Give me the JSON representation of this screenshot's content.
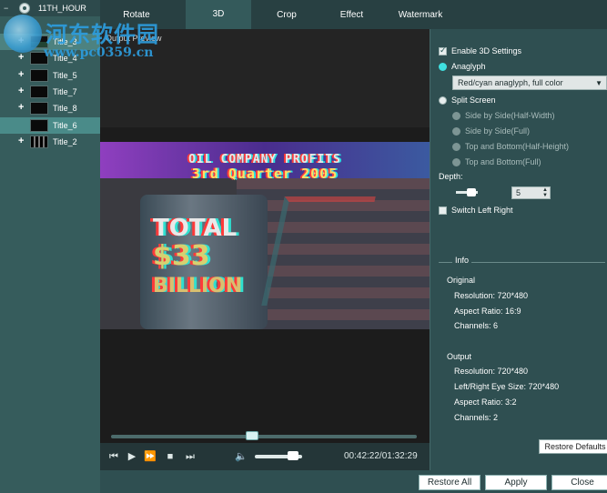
{
  "tree": {
    "root_label": "11TH_HOUR",
    "items": [
      {
        "label": "Title_3",
        "expander": "+"
      },
      {
        "label": "Title_4",
        "expander": "+"
      },
      {
        "label": "Title_5",
        "expander": "+"
      },
      {
        "label": "Title_7",
        "expander": "+"
      },
      {
        "label": "Title_8",
        "expander": "+"
      },
      {
        "label": "Title_6",
        "expander": ""
      },
      {
        "label": "Title_2",
        "expander": "+"
      }
    ]
  },
  "watermark": {
    "cn": "河东软件园",
    "url": "www.pc0359.cn"
  },
  "tabs": [
    {
      "label": "Rotate",
      "active": false
    },
    {
      "label": "3D",
      "active": true
    },
    {
      "label": "Crop",
      "active": false
    },
    {
      "label": "Effect",
      "active": false
    },
    {
      "label": "Watermark",
      "active": false
    }
  ],
  "preview": {
    "title": "Output Preview",
    "video_line1": "OIL COMPANY PROFITS",
    "video_line2": "3rd Quarter 2005",
    "video_total": "TOTAL",
    "video_amount": "$33",
    "video_billion": "BILLION",
    "seek_fraction": 0.46
  },
  "controls": {
    "prev_icon": "skip-back-icon",
    "play_icon": "play-icon",
    "ff_icon": "fast-forward-icon",
    "stop_icon": "stop-icon",
    "next_icon": "skip-forward-icon",
    "volume_icon": "speaker-icon",
    "volume_fraction": 0.8,
    "timecode": "00:42:22/01:32:29"
  },
  "settings": {
    "enable_3d": "Enable 3D Settings",
    "anaglyph": "Anaglyph",
    "anaglyph_mode": "Red/cyan anaglyph, full color",
    "split_screen": "Split Screen",
    "split_options": [
      "Side by Side(Half-Width)",
      "Side by Side(Full)",
      "Top and Bottom(Half-Height)",
      "Top and Bottom(Full)"
    ],
    "depth_label": "Depth:",
    "depth_value": "5",
    "switch_lr": "Switch Left Right",
    "info_title": "Info",
    "original_title": "Original",
    "original": [
      "Resolution: 720*480",
      "Aspect Ratio: 16:9",
      "Channels: 6"
    ],
    "output_title": "Output",
    "output": [
      "Resolution: 720*480",
      "Left/Right Eye Size: 720*480",
      "Aspect Ratio: 3:2",
      "Channels: 2"
    ],
    "restore_defaults": "Restore Defaults"
  },
  "buttons": {
    "restore_all": "Restore All",
    "apply": "Apply",
    "close": "Close"
  }
}
